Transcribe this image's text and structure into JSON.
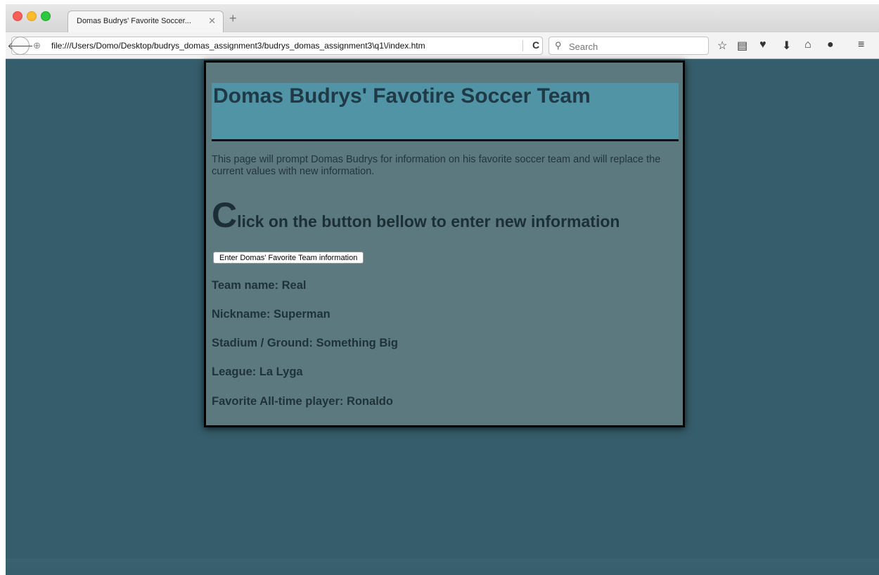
{
  "browser": {
    "tab_title": "Domas Budrys' Favorite Soccer...",
    "tab_close": "✕",
    "new_tab": "+",
    "url": "file:///Users/Domo/Desktop/budrys_domas_assignment3/budrys_domas_assignment3\\q1\\/index.htm",
    "search_placeholder": "Search",
    "icons": {
      "back": "🡐",
      "globe": "⊕",
      "reload": "C",
      "search": "⚲",
      "bookmark": "☆",
      "reading_list": "▤",
      "pocket": "♥",
      "download": "⬇",
      "home": "⌂",
      "chat": "●",
      "menu": "≡"
    }
  },
  "page": {
    "title": "Domas Budrys' Favotire Soccer Team",
    "intro": "This page will prompt Domas Budrys for information on his favorite soccer team and will replace the current values with new information.",
    "cta_first_letter": "C",
    "cta_rest": "lick on the button bellow to enter new information",
    "button_label": "Enter Domas' Favorite Team information",
    "team_name": "Team name: Real",
    "nickname": "Nickname: Superman",
    "stadium": "Stadium / Ground: Something Big",
    "league": "League: La Lyga",
    "favorite_player": "Favorite All-time player: Ronaldo"
  },
  "colors": {
    "page_background": "#365d6b",
    "container_background": "#5c7980",
    "header_background": "#5094a6",
    "title_text": "#1f3a46"
  }
}
